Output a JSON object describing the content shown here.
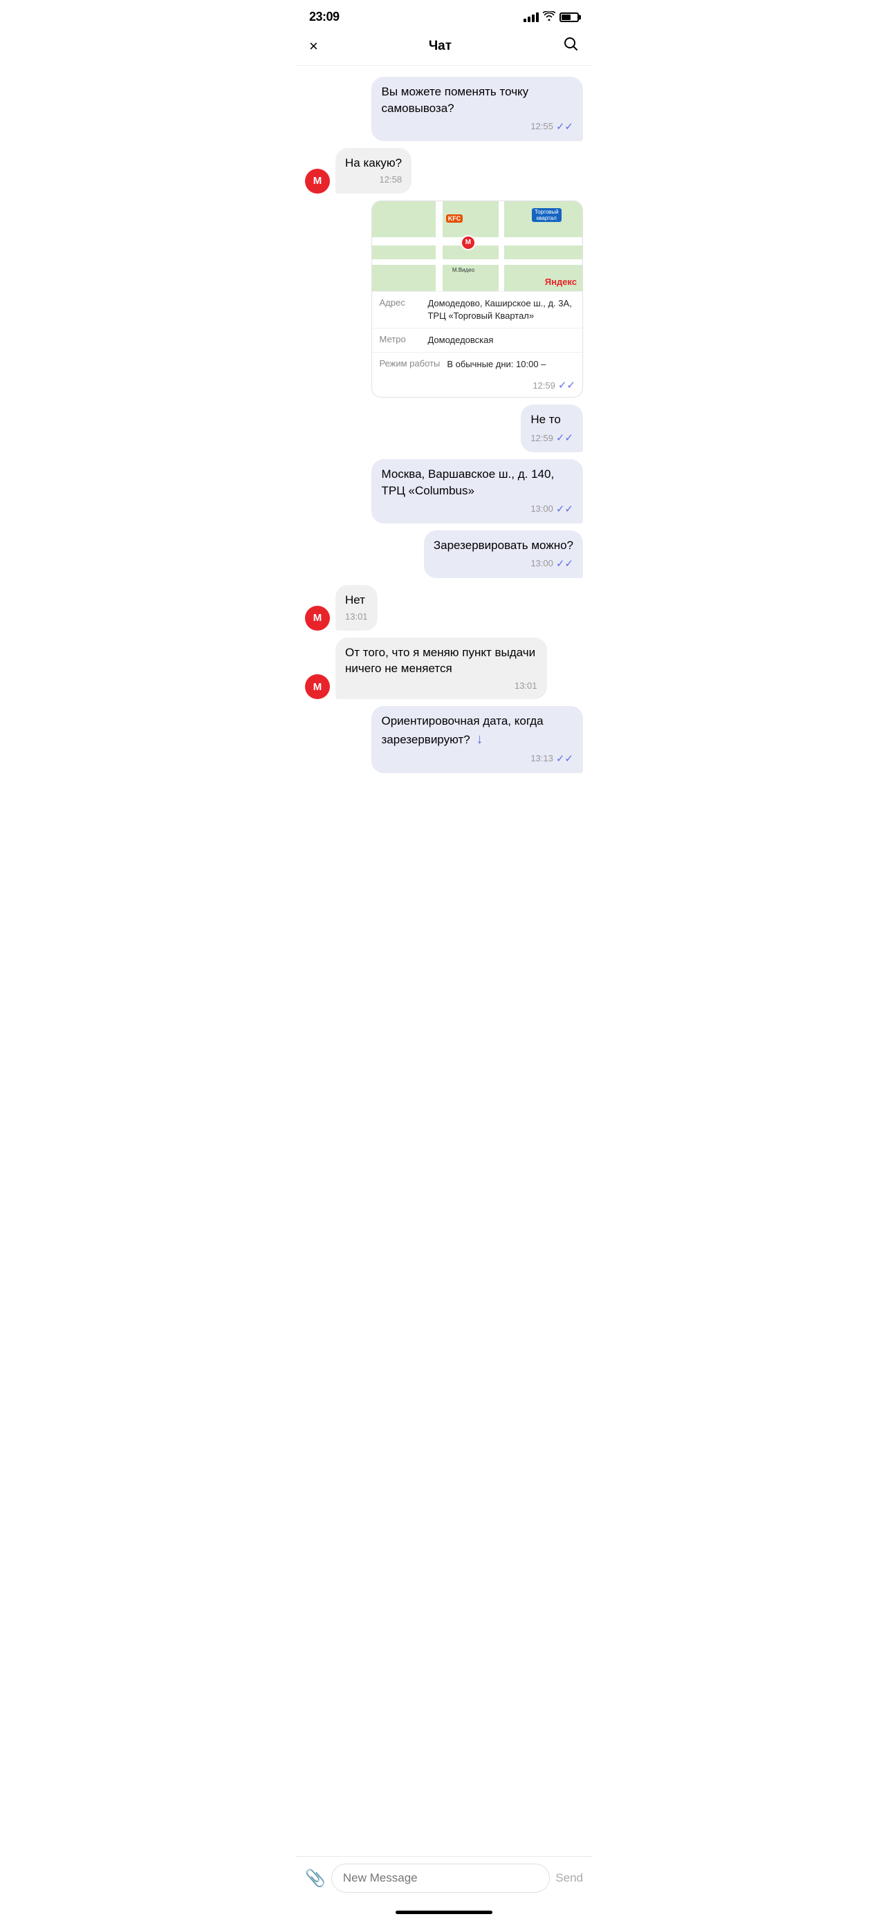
{
  "statusBar": {
    "time": "23:09",
    "hasLocation": true
  },
  "navBar": {
    "title": "Чат",
    "closeLabel": "×",
    "searchLabel": "⌕"
  },
  "messages": [
    {
      "id": "msg1",
      "type": "sent",
      "text": "Вы можете поменять точку самовывоза?",
      "time": "12:55",
      "hasCheck": true
    },
    {
      "id": "msg2",
      "type": "received",
      "text": "На какую?",
      "time": "12:58",
      "hasAvatar": true,
      "avatarLabel": "М"
    },
    {
      "id": "msg3",
      "type": "sent-map",
      "time": "12:59",
      "hasCheck": true,
      "map": {
        "addressLabel": "Адрес",
        "addressValue": "Домодедово, Каширское ш., д. 3А, ТРЦ «Торговый Квартал»",
        "metroLabel": "Метро",
        "metroValue": "Домодедовская",
        "workLabel": "Режим работы",
        "workValue": "В обычные дни: 10:00 –"
      }
    },
    {
      "id": "msg4",
      "type": "sent",
      "text": "Не то",
      "time": "12:59",
      "hasCheck": true
    },
    {
      "id": "msg5",
      "type": "sent",
      "text": "Москва, Варшавское ш., д. 140, ТРЦ «Columbus»",
      "time": "13:00",
      "hasCheck": true
    },
    {
      "id": "msg6",
      "type": "sent",
      "text": "Зарезервировать можно?",
      "time": "13:00",
      "hasCheck": true
    },
    {
      "id": "msg7",
      "type": "received",
      "text": "Нет",
      "time": "13:01",
      "hasAvatar": true,
      "avatarLabel": "М"
    },
    {
      "id": "msg8",
      "type": "received",
      "text": "От того, что я меняю пункт выдачи ничего не меняется",
      "time": "13:01",
      "hasAvatar": true,
      "avatarLabel": "М"
    },
    {
      "id": "msg9",
      "type": "sent",
      "text": "Ориентировочная дата, когда зарезервируют?",
      "time": "13:13",
      "hasCheck": true,
      "hasArrow": true
    }
  ],
  "inputBar": {
    "placeholder": "New Message",
    "attachIcon": "📎",
    "sendLabel": "Send"
  }
}
